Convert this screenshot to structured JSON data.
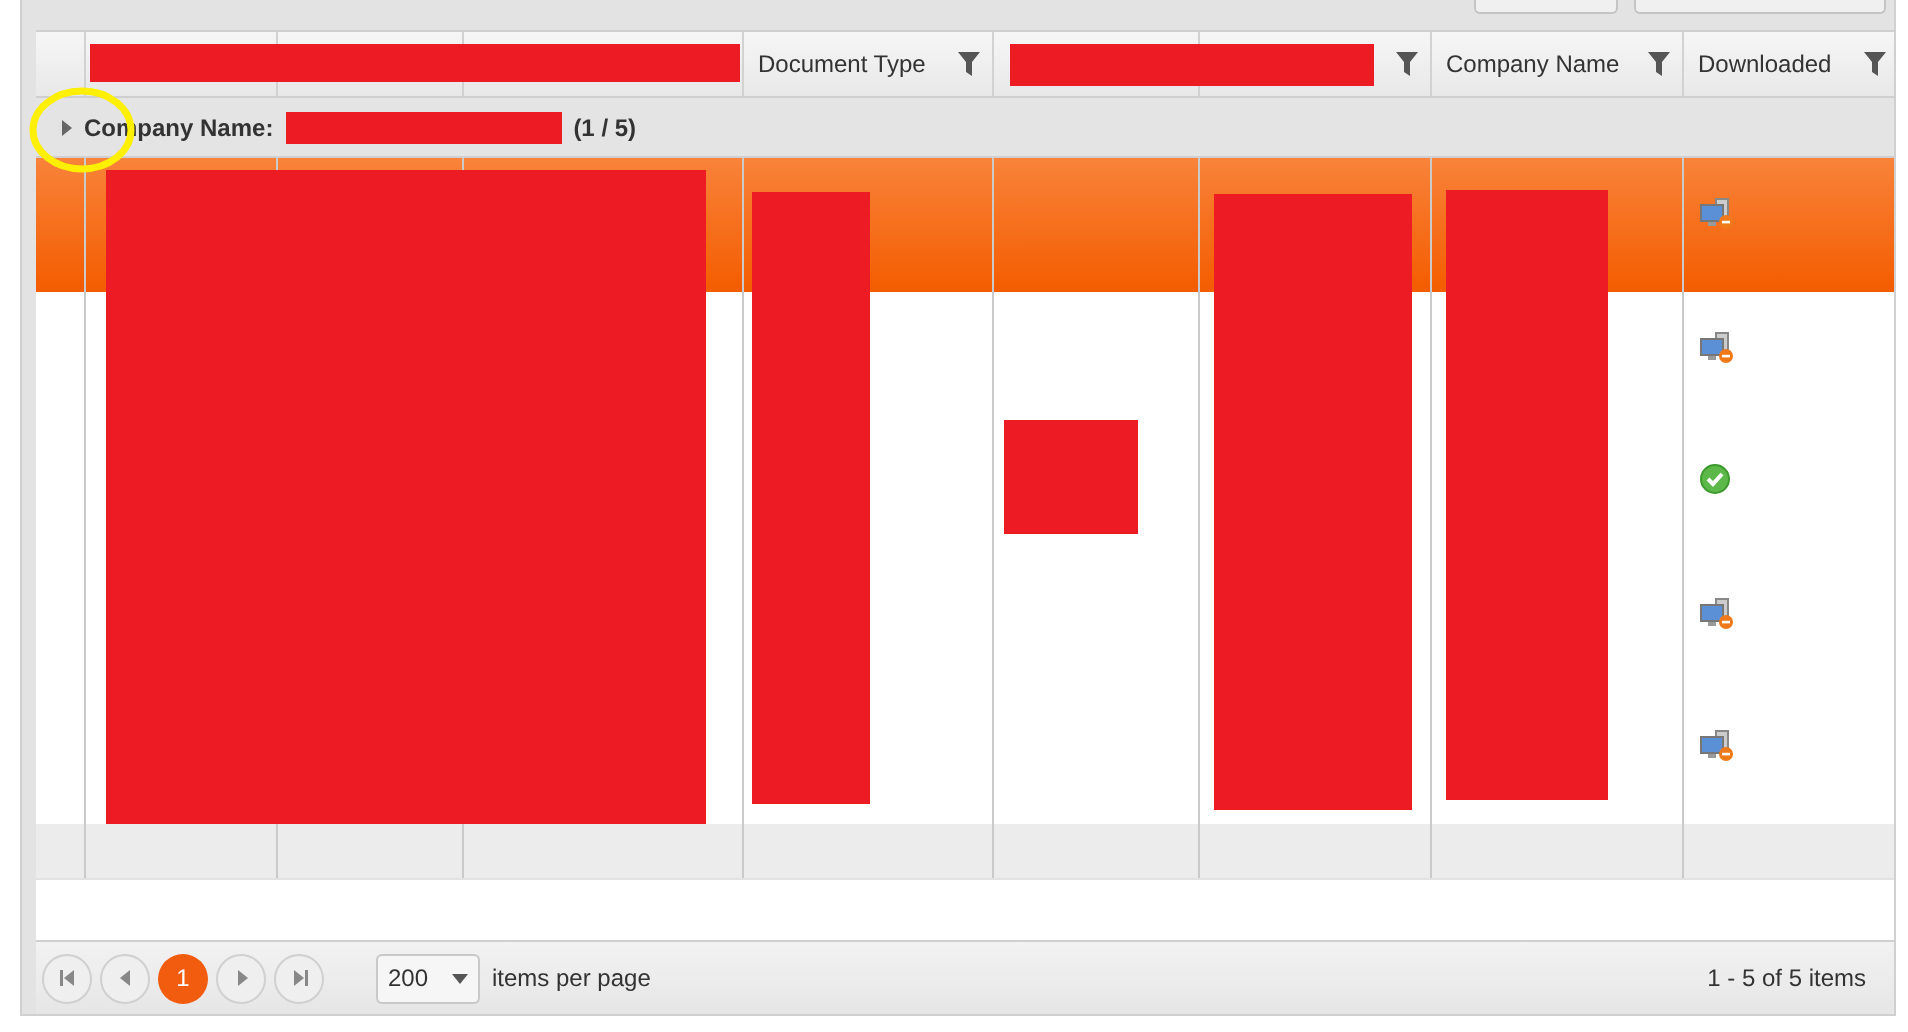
{
  "columns": [
    {},
    {},
    {},
    {
      "label": "Document Type",
      "filter": true
    },
    {},
    {
      "filter": true
    },
    {
      "label": "Company Name",
      "filter": true
    },
    {
      "label": "Downloaded",
      "filter": true
    }
  ],
  "group": {
    "expanded": false,
    "label": "Company Name:",
    "count": "(1 / 5)"
  },
  "rows": [
    {
      "selected": true,
      "downloaded": false
    },
    {
      "selected": false,
      "downloaded": false
    },
    {
      "selected": false,
      "downloaded": true
    },
    {
      "selected": false,
      "downloaded": false
    },
    {
      "selected": false,
      "downloaded": false
    }
  ],
  "pager": {
    "pages": [
      {
        "label": "1",
        "selected": true
      }
    ],
    "page_size": "200",
    "page_size_label": "items per page",
    "summary": "1 - 5 of 5 items"
  }
}
